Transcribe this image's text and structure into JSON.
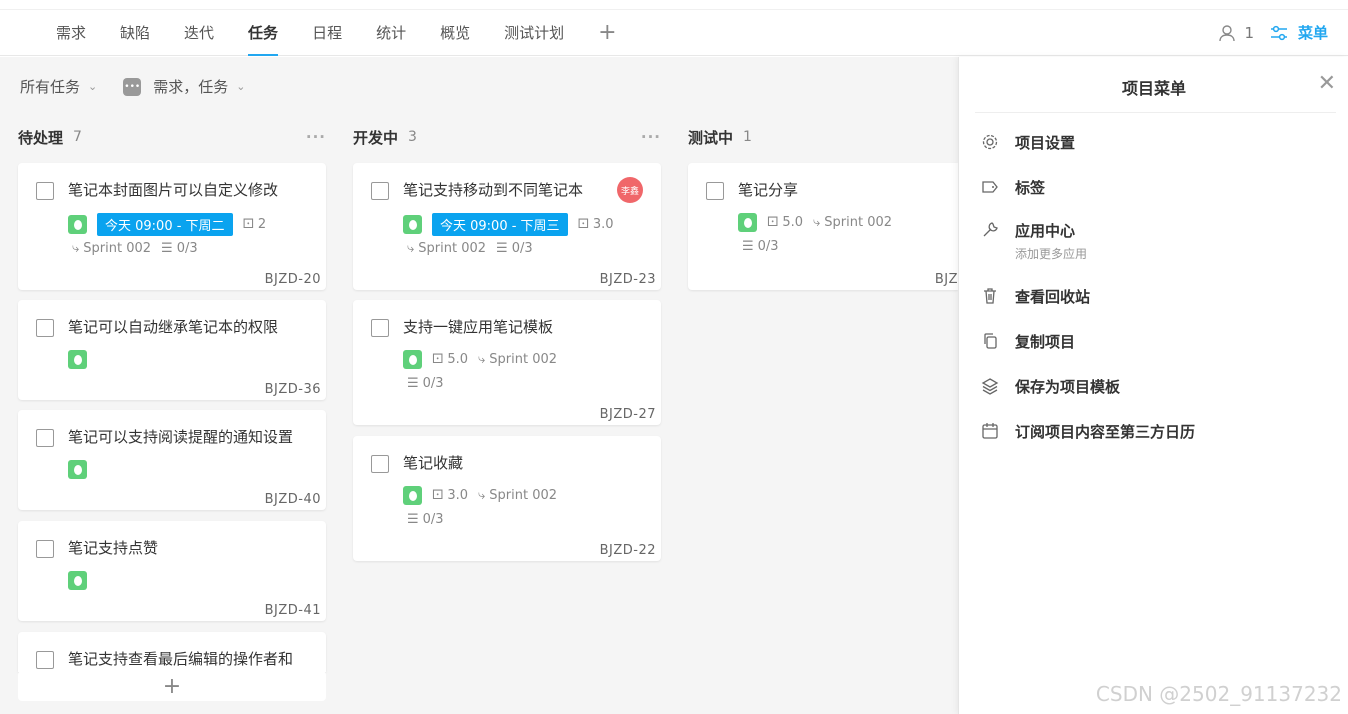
{
  "nav": {
    "tabs": [
      "需求",
      "缺陷",
      "迭代",
      "任务",
      "日程",
      "统计",
      "概览",
      "测试计划"
    ],
    "active_tab": "任务",
    "add_icon": "plus-icon",
    "member_count": "1",
    "menu_label": "菜单",
    "accent_color": "#22a7f0"
  },
  "filters": {
    "scope": "所有任务",
    "types": "需求，任务"
  },
  "columns": [
    {
      "title": "待处理",
      "count": "7",
      "cards": [
        {
          "title": "笔记本封面图片可以自定义修改",
          "date": "今天 09:00 - 下周二",
          "points": "2",
          "sprint": "Sprint 002",
          "subtasks": "0/3",
          "id": "BJZD-20"
        },
        {
          "title": "笔记可以自动继承笔记本的权限",
          "id": "BJZD-36"
        },
        {
          "title": "笔记可以支持阅读提醒的通知设置",
          "id": "BJZD-40"
        },
        {
          "title": "笔记支持点赞",
          "id": "BJZD-41"
        },
        {
          "title": "笔记支持查看最后编辑的操作者和"
        }
      ]
    },
    {
      "title": "开发中",
      "count": "3",
      "cards": [
        {
          "title": "笔记支持移动到不同笔记本",
          "assignee": "李鑫",
          "date": "今天 09:00 - 下周三",
          "points": "3.0",
          "sprint": "Sprint 002",
          "subtasks": "0/3",
          "id": "BJZD-23"
        },
        {
          "title": "支持一键应用笔记模板",
          "points": "5.0",
          "sprint": "Sprint 002",
          "subtasks": "0/3",
          "id": "BJZD-27"
        },
        {
          "title": "笔记收藏",
          "points": "3.0",
          "sprint": "Sprint 002",
          "subtasks": "0/3",
          "id": "BJZD-22"
        }
      ]
    },
    {
      "title": "测试中",
      "count": "1",
      "cards": [
        {
          "title": "笔记分享",
          "points": "5.0",
          "sprint": "Sprint 002",
          "subtasks": "0/3",
          "id": "BJZ"
        }
      ]
    }
  ],
  "panel": {
    "title": "项目菜单",
    "items": [
      {
        "label": "项目设置",
        "icon": "gear-icon"
      },
      {
        "label": "标签",
        "icon": "tag-icon"
      },
      {
        "label": "应用中心",
        "sub": "添加更多应用",
        "icon": "wrench-icon"
      },
      {
        "label": "查看回收站",
        "icon": "trash-icon"
      },
      {
        "label": "复制项目",
        "icon": "copy-icon"
      },
      {
        "label": "保存为项目模板",
        "icon": "layers-icon"
      },
      {
        "label": "订阅项目内容至第三方日历",
        "icon": "calendar-icon"
      }
    ]
  },
  "watermark": "CSDN @2502_91137232"
}
